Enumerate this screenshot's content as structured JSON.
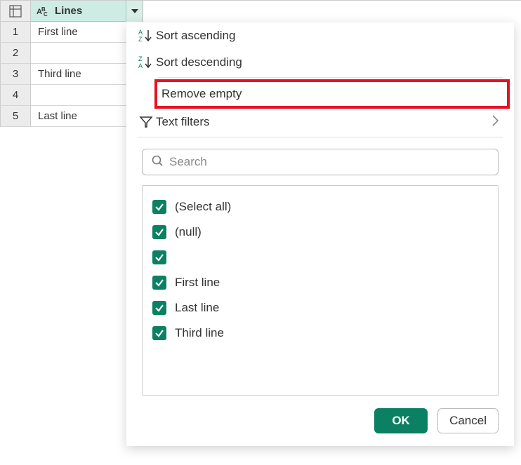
{
  "column": {
    "name": "Lines"
  },
  "rows": [
    {
      "num": "1",
      "value": "First line"
    },
    {
      "num": "2",
      "value": ""
    },
    {
      "num": "3",
      "value": "Third line"
    },
    {
      "num": "4",
      "value": ""
    },
    {
      "num": "5",
      "value": "Last line"
    }
  ],
  "menu": {
    "sort_asc": "Sort ascending",
    "sort_desc": "Sort descending",
    "remove_empty": "Remove empty",
    "text_filters": "Text filters"
  },
  "search": {
    "placeholder": "Search"
  },
  "filter_values": [
    {
      "label": "(Select all)"
    },
    {
      "label": "(null)"
    },
    {
      "label": ""
    },
    {
      "label": "First line"
    },
    {
      "label": "Last line"
    },
    {
      "label": "Third line"
    }
  ],
  "buttons": {
    "ok": "OK",
    "cancel": "Cancel"
  }
}
